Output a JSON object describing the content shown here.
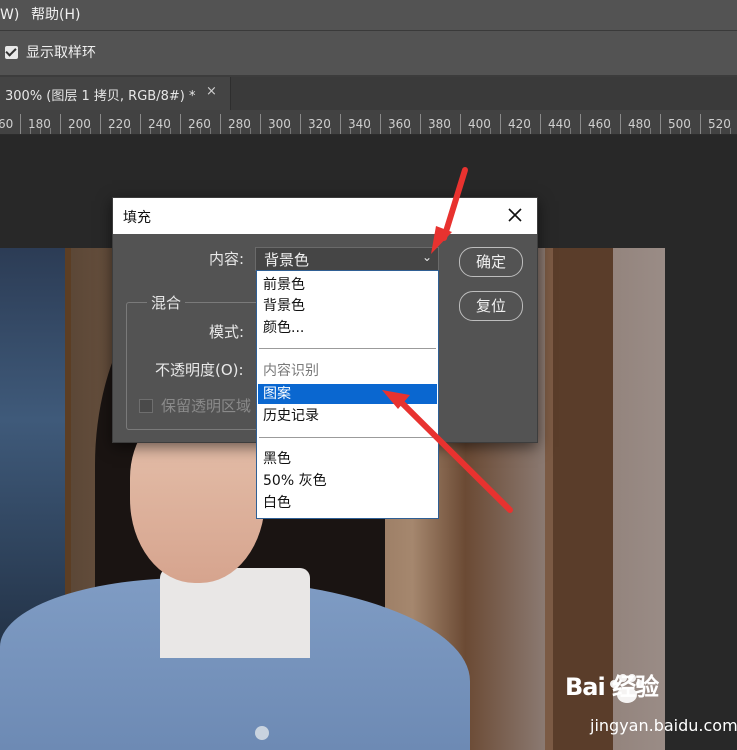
{
  "menubar": {
    "items": [
      "W)",
      "帮助(H)"
    ]
  },
  "options": {
    "checkbox_label": "显示取样环",
    "checkbox_checked": true
  },
  "tab": {
    "title": "300% (图层 1 拷贝, RGB/8#) *",
    "close": "×"
  },
  "ruler": {
    "labels": [
      "60",
      "180",
      "200",
      "220",
      "240",
      "260",
      "280",
      "300",
      "320",
      "340",
      "360",
      "380",
      "400",
      "420",
      "440",
      "460",
      "480",
      "500",
      "520"
    ]
  },
  "dialog": {
    "title": "填充",
    "close_icon": "close-icon",
    "content_label": "内容:",
    "content_value": "背景色",
    "chevron": "⌄",
    "ok_label": "确定",
    "reset_label": "复位",
    "blend_group": "混合",
    "mode_label": "模式:",
    "opacity_label": "不透明度(O):",
    "preserve_label": "保留透明区域"
  },
  "dropdown": {
    "items": [
      {
        "label": "前景色",
        "state": "normal"
      },
      {
        "label": "背景色",
        "state": "normal"
      },
      {
        "label": "颜色...",
        "state": "normal"
      },
      {
        "label": "内容识别",
        "state": "disabled"
      },
      {
        "label": "图案",
        "state": "selected"
      },
      {
        "label": "历史记录",
        "state": "normal"
      },
      {
        "label": "黑色",
        "state": "normal"
      },
      {
        "label": "50% 灰色",
        "state": "normal"
      },
      {
        "label": "白色",
        "state": "normal"
      }
    ]
  },
  "colors": {
    "selection": "#0a67d0",
    "arrow": "#e8322f",
    "panel": "#535353"
  },
  "watermark": {
    "brand": "Bai 经验",
    "site": "jingyan.baidu.com"
  }
}
